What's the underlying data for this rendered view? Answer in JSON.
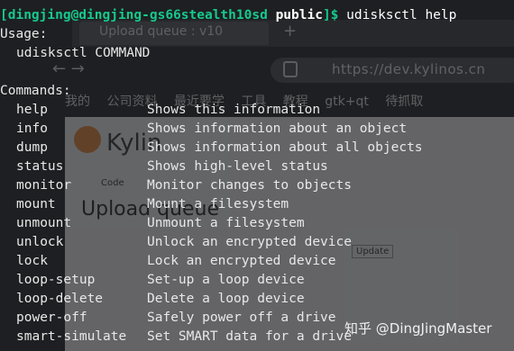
{
  "background": {
    "tab_title": "Upload queue : v10",
    "tab_plus": "+",
    "address": "https://dev.kylinos.cn",
    "bookmarks": "我的 公司资料 最近要学 工具 教程 gtk+qt 待抓取",
    "site_name": "Kylin",
    "page_heading": "Upload queue",
    "code_tab": "Code",
    "update_button": "Update"
  },
  "terminal": {
    "prompt": {
      "open_bracket": "[",
      "user_host": "dingjing@dingjing-gs66stealth10sd",
      "cwd": "public",
      "close": "]$",
      "command": "udisksctl help"
    },
    "usage_header": "Usage:",
    "usage_line": "udisksctl COMMAND",
    "commands_header": "Commands:",
    "commands": [
      {
        "name": "help",
        "description": "Shows this information"
      },
      {
        "name": "info",
        "description": "Shows information about an object"
      },
      {
        "name": "dump",
        "description": "Shows information about all objects"
      },
      {
        "name": "status",
        "description": "Shows high-level status"
      },
      {
        "name": "monitor",
        "description": "Monitor changes to objects"
      },
      {
        "name": "mount",
        "description": "Mount a filesystem"
      },
      {
        "name": "unmount",
        "description": "Unmount a filesystem"
      },
      {
        "name": "unlock",
        "description": "Unlock an encrypted device"
      },
      {
        "name": "lock",
        "description": "Lock an encrypted device"
      },
      {
        "name": "loop-setup",
        "description": "Set-up a loop device"
      },
      {
        "name": "loop-delete",
        "description": "Delete a loop device"
      },
      {
        "name": "power-off",
        "description": "Safely power off a drive"
      },
      {
        "name": "smart-simulate",
        "description": "Set SMART data for a drive"
      }
    ]
  },
  "watermark": "知乎 @DingJingMaster",
  "colors": {
    "terminal_bg": "#1e1f22",
    "prompt_green": "#16c98d",
    "text": "#e8e8e8"
  }
}
